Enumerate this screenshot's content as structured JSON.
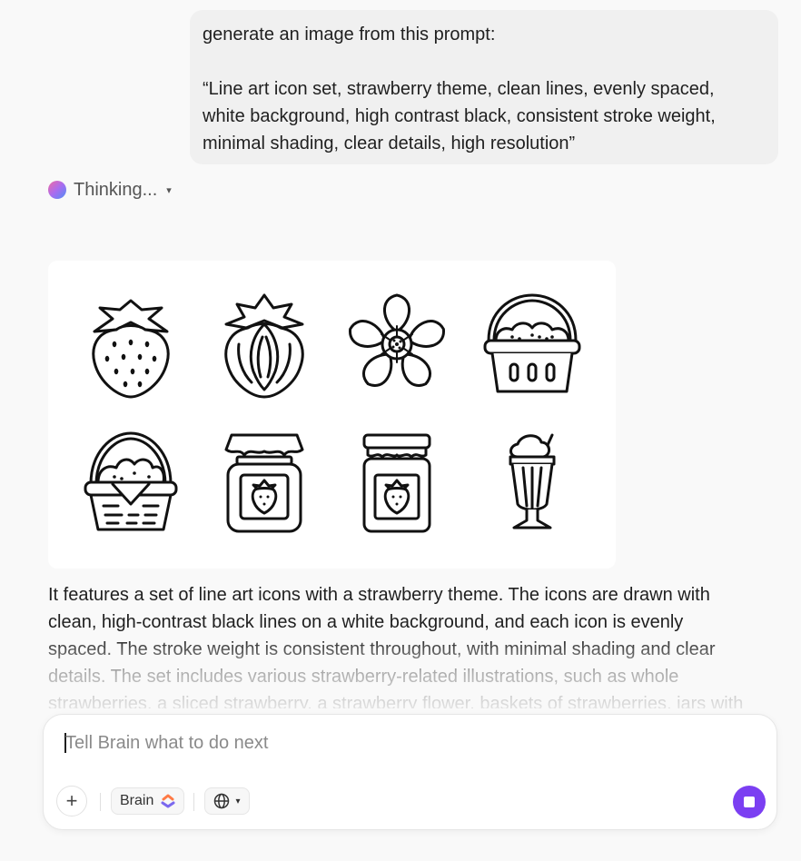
{
  "user_message": {
    "line1": "generate an image from this prompt:",
    "prompt_lines": [
      "“Line art icon set, strawberry theme, clean lines, evenly spaced,",
      "white background, high contrast black, consistent stroke weight,",
      "minimal shading, clear details, high resolution”"
    ]
  },
  "thinking": {
    "label": "Thinking...",
    "icon": "gradient-orb-icon",
    "caret": "▾"
  },
  "generated_image": {
    "icons": [
      "whole-strawberry-icon",
      "sliced-strawberry-icon",
      "strawberry-flower-icon",
      "strawberry-basket-icon",
      "woven-basket-icon",
      "jam-jar-icon",
      "tall-jam-jar-icon",
      "milkshake-icon"
    ]
  },
  "answer": {
    "lines": [
      "It features a set of line art icons with a strawberry theme. The icons are drawn with",
      "clean, high-contrast black lines on a white background, and each icon is evenly",
      "spaced. The stroke weight is consistent throughout, with minimal shading and clear",
      "details. The set includes various strawberry-related illustrations, such as whole",
      "strawberries, a sliced strawberry, a strawberry flower, baskets of strawberries, jars with"
    ]
  },
  "composer": {
    "placeholder": "Tell Brain what to do next",
    "brain_label": "Brain",
    "add_icon": "+",
    "globe_caret": "▾"
  },
  "colors": {
    "accent": "#7b3ff2",
    "bubble": "#f0f0f0",
    "background": "#f9f9f9"
  }
}
